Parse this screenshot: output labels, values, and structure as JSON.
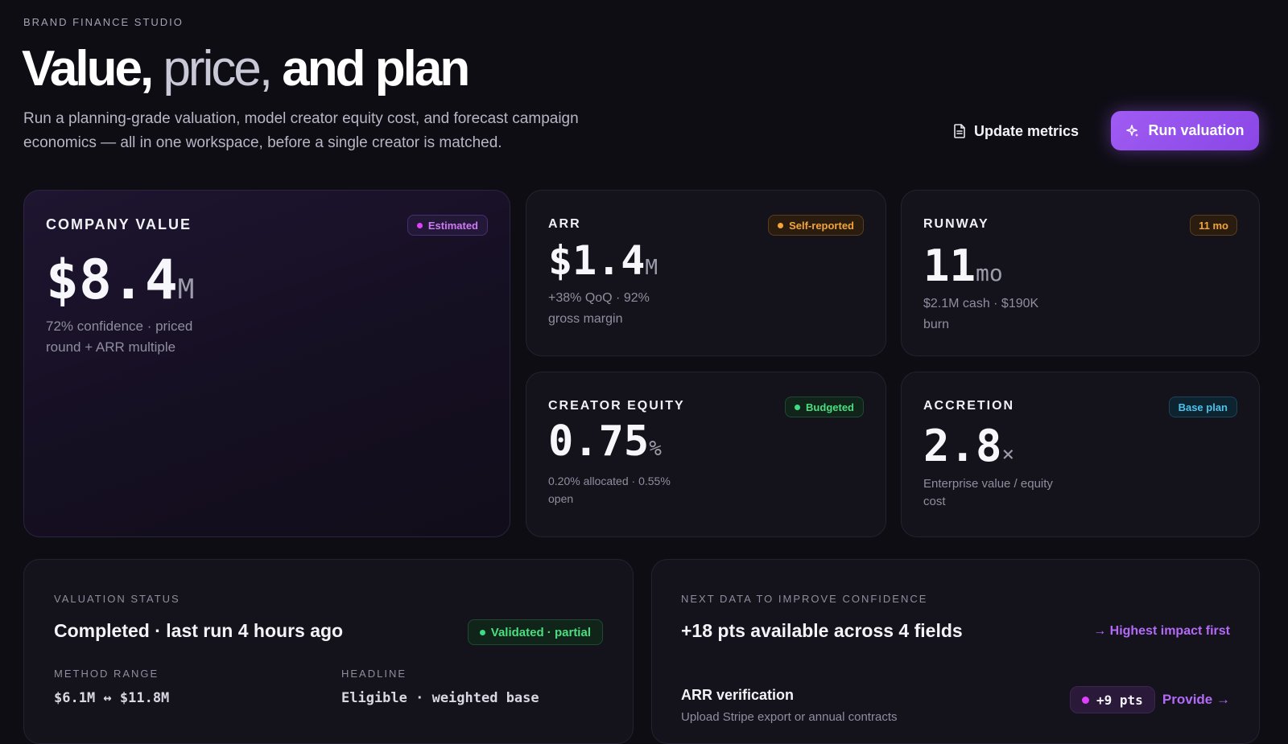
{
  "header": {
    "eyebrow": "BRAND FINANCE STUDIO",
    "title_part1": "Value,",
    "title_part2": "price,",
    "title_part3": "and plan",
    "subtitle": "Run a planning-grade valuation, model creator equity cost, and forecast campaign economics — all in one workspace, before a single creator is matched."
  },
  "actions": {
    "update_label": "Update metrics",
    "update_icon": "document-icon",
    "run_label": "Run valuation",
    "run_icon": "sparkle-icon"
  },
  "colors": {
    "accent": "#9f5bf2",
    "magenta": "#e040fb",
    "orange": "#f2a53a",
    "green": "#3ddc84",
    "cyan": "#3ab8e0"
  },
  "cards": {
    "company_value": {
      "label": "COMPANY VALUE",
      "badge": "Estimated",
      "value": "$8.4",
      "unit": "M",
      "sub": "72% confidence · priced round + ARR multiple"
    },
    "arr": {
      "label": "ARR",
      "badge": "Self-reported",
      "value": "$1.4",
      "unit": "M",
      "sub": "+38% QoQ · 92% gross margin"
    },
    "runway": {
      "label": "RUNWAY",
      "badge": "11 mo",
      "value": "11",
      "unit": "mo",
      "sub": "$2.1M cash · $190K burn"
    },
    "creator_equity": {
      "label": "CREATOR EQUITY",
      "badge": "Budgeted",
      "value": "0.75",
      "unit": "%",
      "sub": "0.20% allocated · 0.55% open"
    },
    "accretion": {
      "label": "ACCRETION",
      "badge": "Base plan",
      "value": "2.8",
      "unit": "×",
      "sub": "Enterprise value / equity cost"
    }
  },
  "valuation_status": {
    "label": "VALUATION STATUS",
    "title": "Completed · last run 4 hours ago",
    "badge": "Validated · partial",
    "method_label": "METHOD RANGE",
    "method_value": "$6.1M ↔ $11.8M",
    "headline_label": "HEADLINE",
    "headline_value": "Eligible · weighted base"
  },
  "next_data": {
    "label": "NEXT DATA TO IMPROVE CONFIDENCE",
    "title": "+18 pts available across 4 fields",
    "link": "→ Highest impact first",
    "item_title": "ARR verification",
    "item_desc": "Upload Stripe export or annual contracts",
    "item_pts": "+9 pts",
    "item_action": "Provide →"
  }
}
